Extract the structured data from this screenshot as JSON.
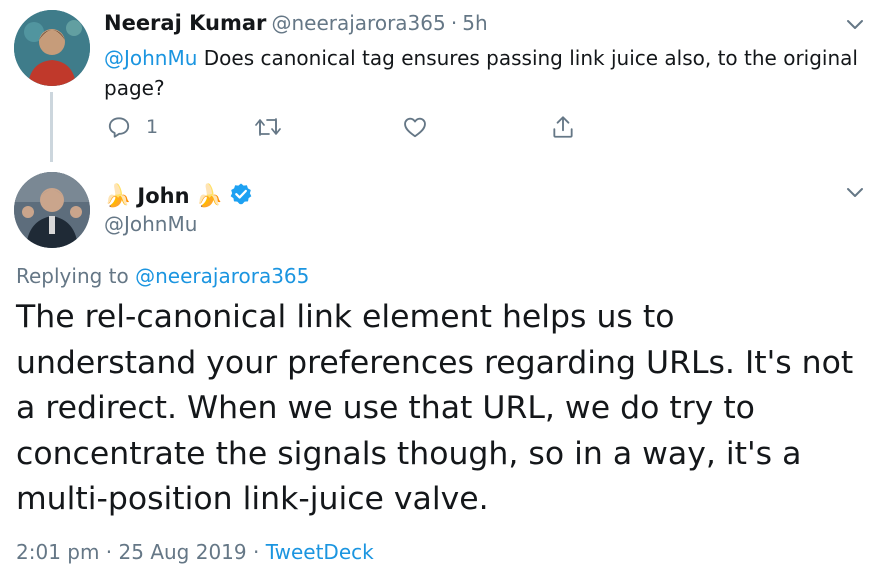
{
  "tweet1": {
    "author_name": "Neeraj Kumar",
    "handle": "@neerajarora365",
    "separator": "·",
    "time": "5h",
    "mention": "@JohnMu",
    "text": " Does canonical tag ensures passing link juice also, to the original page?",
    "reply_count": "1",
    "avatar_colors": {
      "bg": "#3f7c8a",
      "shirt": "#c0392b"
    }
  },
  "tweet2": {
    "banana_left": "🍌",
    "author_name": "John",
    "banana_right": "🍌",
    "verified": true,
    "handle": "@JohnMu",
    "replying_prefix": "Replying to ",
    "replying_handle": "@neerajarora365",
    "text": "The rel-canonical link element helps us to understand your preferences regarding URLs. It's not a redirect. When we use that URL, we do try to concentrate the signals though, so in a way, it's a multi-position link-juice valve.",
    "time": "2:01 pm · 25 Aug 2019 · ",
    "source": "TweetDeck"
  },
  "colors": {
    "link": "#1b95e0",
    "muted": "#657786",
    "text": "#14171a",
    "thread_line": "#ccd6dd"
  },
  "icons": [
    "reply-icon",
    "retweet-icon",
    "like-icon",
    "share-icon",
    "chevron-down-icon",
    "verified-badge-icon",
    "banana-icon"
  ]
}
